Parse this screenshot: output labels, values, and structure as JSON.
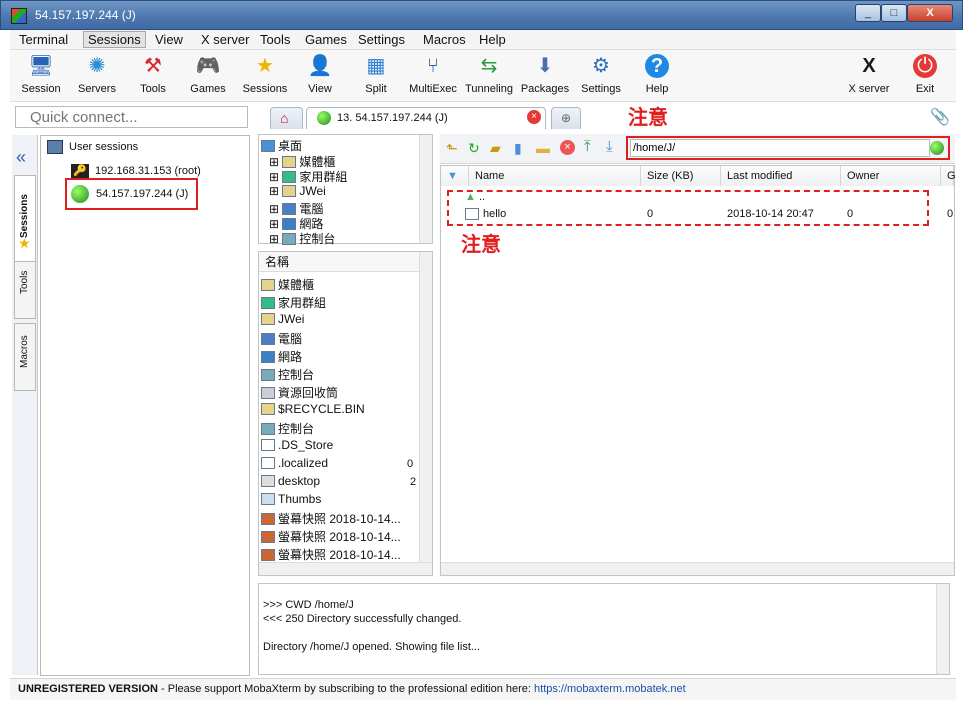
{
  "window": {
    "title": "54.157.197.244 (J)",
    "minimize": "_",
    "maximize": "□",
    "close": "X"
  },
  "menu": [
    "Terminal",
    "Sessions",
    "View",
    "X server",
    "Tools",
    "Games",
    "Settings",
    "Macros",
    "Help"
  ],
  "toolbar": {
    "items": [
      "Session",
      "Servers",
      "Tools",
      "Games",
      "Sessions",
      "View",
      "Split",
      "MultiExec",
      "Tunneling",
      "Packages",
      "Settings",
      "Help"
    ],
    "right_items": [
      "X server",
      "Exit"
    ]
  },
  "quick_connect": {
    "placeholder": "Quick connect..."
  },
  "sidetabs": [
    "Sessions",
    "Tools",
    "Macros"
  ],
  "sessions": {
    "root": "User sessions",
    "items": [
      "192.168.31.153 (root)",
      "54.157.197.244 (J)"
    ]
  },
  "tabs": {
    "active": "13. 54.157.197.244 (J)"
  },
  "local_tree": {
    "root": "桌面",
    "items": [
      "媒體櫃",
      "家用群組",
      "JWei",
      "電腦",
      "網路",
      "控制台"
    ]
  },
  "local_list": {
    "header": "名稱",
    "items": [
      "媒體櫃",
      "家用群組",
      "JWei",
      "電腦",
      "網路",
      "控制台",
      "資源回收筒",
      "$RECYCLE.BIN",
      "控制台",
      ".DS_Store",
      ".localized",
      "desktop",
      "Thumbs",
      "螢幕快照 2018-10-14...",
      "螢幕快照 2018-10-14...",
      "螢幕快照 2018-10-14..."
    ],
    "side_values": [
      "0",
      "2"
    ]
  },
  "remote": {
    "path": "/home/J/",
    "columns": [
      "Name",
      "Size (KB)",
      "Last modified",
      "Owner",
      "G"
    ],
    "rows": [
      {
        "name": "..",
        "size": "",
        "modified": "",
        "owner": ""
      },
      {
        "name": "hello",
        "size": "0",
        "modified": "2018-10-14 20:47",
        "owner": "0",
        "group": "0"
      }
    ]
  },
  "log": {
    "lines": [
      ">>>  CWD /home/J",
      "<<<  250 Directory successfully changed.",
      "Directory /home/J opened. Showing file list..."
    ]
  },
  "status": {
    "bold": "UNREGISTERED VERSION",
    "text": " -  Please support MobaXterm by subscribing to the professional edition here:  ",
    "link": "https://mobaxterm.mobatek.net"
  },
  "annotations": [
    "注意",
    "注意"
  ]
}
